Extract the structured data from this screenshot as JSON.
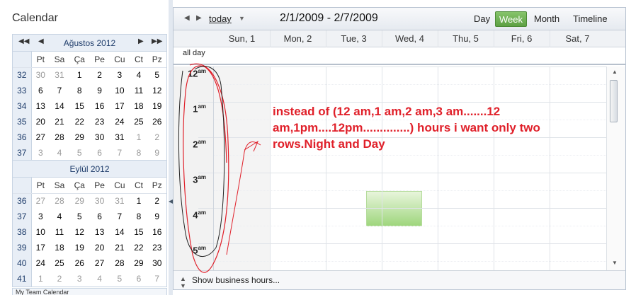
{
  "sidebar": {
    "title": "Calendar",
    "bottom_label": "My Team Calendar",
    "month1": {
      "name": "Ağustos 2012",
      "weekdays": [
        "Pt",
        "Sa",
        "Ça",
        "Pe",
        "Cu",
        "Ct",
        "Pz"
      ],
      "weeks": [
        {
          "wk": "32",
          "days": [
            "30",
            "31",
            "1",
            "2",
            "3",
            "4",
            "5"
          ]
        },
        {
          "wk": "33",
          "days": [
            "6",
            "7",
            "8",
            "9",
            "10",
            "11",
            "12"
          ]
        },
        {
          "wk": "34",
          "days": [
            "13",
            "14",
            "15",
            "16",
            "17",
            "18",
            "19"
          ]
        },
        {
          "wk": "35",
          "days": [
            "20",
            "21",
            "22",
            "23",
            "24",
            "25",
            "26"
          ]
        },
        {
          "wk": "36",
          "days": [
            "27",
            "28",
            "29",
            "30",
            "31",
            "1",
            "2"
          ]
        },
        {
          "wk": "37",
          "days": [
            "3",
            "4",
            "5",
            "6",
            "7",
            "8",
            "9"
          ]
        }
      ]
    },
    "month2": {
      "name": "Eylül 2012",
      "weekdays": [
        "Pt",
        "Sa",
        "Ça",
        "Pe",
        "Cu",
        "Ct",
        "Pz"
      ],
      "weeks": [
        {
          "wk": "36",
          "days": [
            "27",
            "28",
            "29",
            "30",
            "31",
            "1",
            "2"
          ]
        },
        {
          "wk": "37",
          "days": [
            "3",
            "4",
            "5",
            "6",
            "7",
            "8",
            "9"
          ]
        },
        {
          "wk": "38",
          "days": [
            "10",
            "11",
            "12",
            "13",
            "14",
            "15",
            "16"
          ]
        },
        {
          "wk": "39",
          "days": [
            "17",
            "18",
            "19",
            "20",
            "21",
            "22",
            "23"
          ]
        },
        {
          "wk": "40",
          "days": [
            "24",
            "25",
            "26",
            "27",
            "28",
            "29",
            "30"
          ]
        },
        {
          "wk": "41",
          "days": [
            "1",
            "2",
            "3",
            "4",
            "5",
            "6",
            "7"
          ]
        }
      ]
    }
  },
  "toolbar": {
    "today_label": "today",
    "date_range": "2/1/2009 - 2/7/2009",
    "views": [
      "Day",
      "Week",
      "Month",
      "Timeline"
    ],
    "active_view": "Week"
  },
  "days": [
    "Sun, 1",
    "Mon, 2",
    "Tue, 3",
    "Wed, 4",
    "Thu, 5",
    "Fri, 6",
    "Sat, 7"
  ],
  "all_day_label": "all day",
  "hours": [
    {
      "h": "12",
      "ampm": "am"
    },
    {
      "h": "1",
      "ampm": "am"
    },
    {
      "h": "2",
      "ampm": "am"
    },
    {
      "h": "3",
      "ampm": "am"
    },
    {
      "h": "4",
      "ampm": "am"
    },
    {
      "h": "5",
      "ampm": "am"
    }
  ],
  "footer": {
    "business_hours_label": "Show business hours..."
  },
  "annotation": {
    "text": "instead of (12 am,1 am,2 am,3 am.......12 am,1pm....12pm..............) hours i want  only two rows.Night and Day",
    "color": "#e0202a"
  },
  "colors": {
    "active_view_green": "#5da043",
    "event_green": "#9fd67d"
  }
}
